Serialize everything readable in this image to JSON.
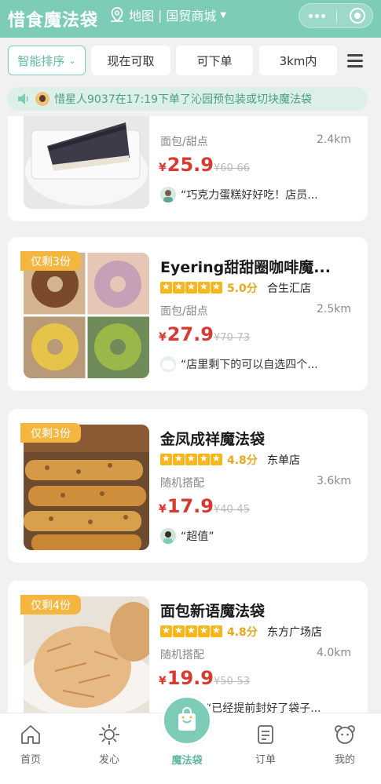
{
  "header": {
    "title": "惜食魔法袋",
    "map_label": "地图",
    "location": "国贸商城"
  },
  "filters": {
    "sort": "智能排序",
    "available_now": "现在可取",
    "orderable": "可下单",
    "distance": "3km内"
  },
  "notice": {
    "text": "惜星人9037在17:19下单了沁园预包装或切块魔法袋"
  },
  "cards": [
    {
      "badge": "",
      "name": "",
      "rating": "",
      "branch": "",
      "category": "面包/甜点",
      "distance": "2.4km",
      "price": "25.9",
      "original_price": "¥60-66",
      "review": "“巧克力蛋糕好好吃！店员..."
    },
    {
      "badge": "仅剩3份",
      "name": "Eyering甜甜圈咖啡魔...",
      "rating": "5.0分",
      "branch": "合生汇店",
      "category": "面包/甜点",
      "distance": "2.5km",
      "price": "27.9",
      "original_price": "¥70-73",
      "review": "“店里剩下的可以自选四个..."
    },
    {
      "badge": "仅剩3份",
      "name": "金凤成祥魔法袋",
      "rating": "4.8分",
      "branch": "东单店",
      "category": "随机搭配",
      "distance": "3.6km",
      "price": "17.9",
      "original_price": "¥40-45",
      "review": "“超值”"
    },
    {
      "badge": "仅剩4份",
      "name": "面包新语魔法袋",
      "rating": "4.8分",
      "branch": "东方广场店",
      "category": "随机搭配",
      "distance": "4.0km",
      "price": "19.9",
      "original_price": "¥50-53",
      "review": "“已经提前封好了袋子..."
    }
  ],
  "currency": "¥",
  "tabbar": {
    "home": "首页",
    "wish": "发心",
    "magic_bag": "魔法袋",
    "orders": "订单",
    "mine": "我的"
  },
  "colors": {
    "brand": "#7cccb8",
    "price": "#d93a30",
    "badge": "#f4b63e",
    "star": "#f5b71c"
  }
}
